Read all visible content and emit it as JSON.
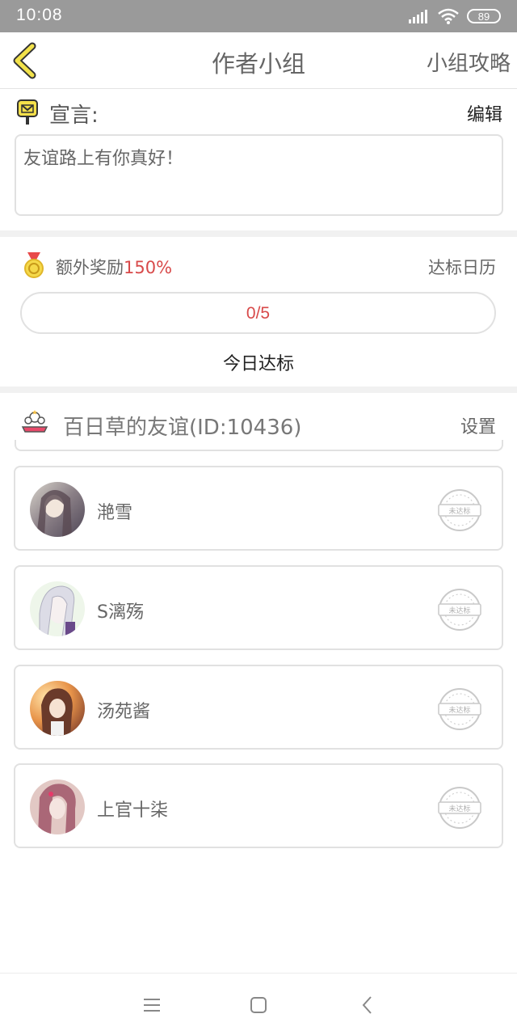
{
  "status_bar": {
    "time": "10:08",
    "battery": "89",
    "icons": [
      "signal-icon",
      "wifi-icon",
      "battery-icon"
    ]
  },
  "header": {
    "title": "作者小组",
    "right_link": "小组攻略",
    "back_icon": "chevron-left-icon"
  },
  "manifesto": {
    "label": "宣言:",
    "edit_label": "编辑",
    "text": "友谊路上有你真好！",
    "icon": "mailbox-icon"
  },
  "reward": {
    "label": "额外奖励",
    "percent": "150%",
    "calendar_link": "达标日历",
    "progress_text": "0/5",
    "progress_fraction": 0,
    "today_label": "今日达标",
    "icon": "medal-icon"
  },
  "group": {
    "name": "百日草的友谊(ID:10436)",
    "settings_label": "设置",
    "icon": "group-icon"
  },
  "members": [
    {
      "name": "滟雪",
      "stamp": "未达标"
    },
    {
      "name": "S漓殇",
      "stamp": "未达标"
    },
    {
      "name": "汤苑酱",
      "stamp": "未达标"
    },
    {
      "name": "上官十柒",
      "stamp": "未达标"
    }
  ],
  "bottom_nav": {
    "icons": [
      "menu-icon",
      "home-icon",
      "back-icon"
    ]
  },
  "colors": {
    "accent_red": "#d84a4a",
    "status_bar": "#9a9a9a",
    "border": "#e1e1e1",
    "back_arrow": "#f2e24b"
  }
}
